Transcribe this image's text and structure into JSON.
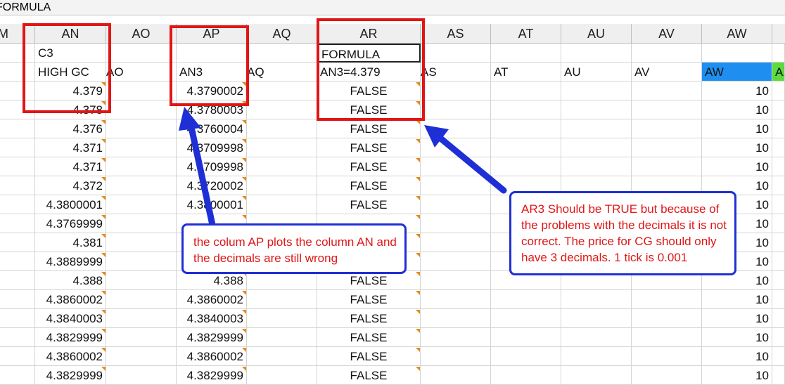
{
  "formula_bar": {
    "text": "FORMULA"
  },
  "columns": [
    {
      "label": "M"
    },
    {
      "label": "AN"
    },
    {
      "label": "AO"
    },
    {
      "label": "AP"
    },
    {
      "label": "AQ"
    },
    {
      "label": "AR"
    },
    {
      "label": "AS"
    },
    {
      "label": "AT"
    },
    {
      "label": "AU"
    },
    {
      "label": "AV"
    },
    {
      "label": "AW"
    }
  ],
  "row1": {
    "an": "C3",
    "ar": "FORMULA"
  },
  "row2": {
    "an": "HIGH GC",
    "ao": "AO",
    "ap": "AN3",
    "aq": "AQ",
    "ar": "AN3=4.379",
    "as": "AS",
    "at": "AT",
    "au": "AU",
    "av": "AV",
    "aw": "AW",
    "ax": "AX"
  },
  "rows": [
    {
      "an": "4.379",
      "ap": "4.3790002",
      "ar": "FALSE",
      "aw": "10"
    },
    {
      "an": "4.378",
      "ap": "4.3780003",
      "ar": "FALSE",
      "aw": "10"
    },
    {
      "an": "4.376",
      "ap": "4.3760004",
      "ar": "FALSE",
      "aw": "10"
    },
    {
      "an": "4.371",
      "ap": "4.3709998",
      "ar": "FALSE",
      "aw": "10"
    },
    {
      "an": "4.371",
      "ap": "4.3709998",
      "ar": "FALSE",
      "aw": "10"
    },
    {
      "an": "4.372",
      "ap": "4.3720002",
      "ar": "FALSE",
      "aw": "10"
    },
    {
      "an": "4.3800001",
      "ap": "4.3800001",
      "ar": "FALSE",
      "aw": "10"
    },
    {
      "an": "4.3769999",
      "ap": "",
      "ar": "",
      "aw": "10"
    },
    {
      "an": "4.381",
      "ap": "",
      "ar": "",
      "aw": "10"
    },
    {
      "an": "4.3889999",
      "ap": "",
      "ar": "",
      "aw": "10"
    },
    {
      "an": "4.388",
      "ap": "4.388",
      "ar": "FALSE",
      "aw": "10"
    },
    {
      "an": "4.3860002",
      "ap": "4.3860002",
      "ar": "FALSE",
      "aw": "10"
    },
    {
      "an": "4.3840003",
      "ap": "4.3840003",
      "ar": "FALSE",
      "aw": "10"
    },
    {
      "an": "4.3829999",
      "ap": "4.3829999",
      "ar": "FALSE",
      "aw": "10"
    },
    {
      "an": "4.3860002",
      "ap": "4.3860002",
      "ar": "FALSE",
      "aw": "10"
    },
    {
      "an": "4.3829999",
      "ap": "4.3829999",
      "ar": "FALSE",
      "aw": "10"
    }
  ],
  "callout_left": {
    "text": "the colum AP plots the column AN and the decimals are still wrong"
  },
  "callout_right": {
    "text": "AR3 Should be TRUE but because of the problems with the decimals it is not correct. The price for CG should only have 3 decimals. 1 tick is 0.001"
  },
  "colors": {
    "annotation_red": "#e01616",
    "arrow_blue": "#1f2fd6",
    "selected_aw": "#1e8ff0",
    "selected_ax": "#5cdc3c",
    "comment_marker": "#e8891c"
  },
  "icons": [
    "comment-indicator-icon",
    "arrow-icon"
  ]
}
